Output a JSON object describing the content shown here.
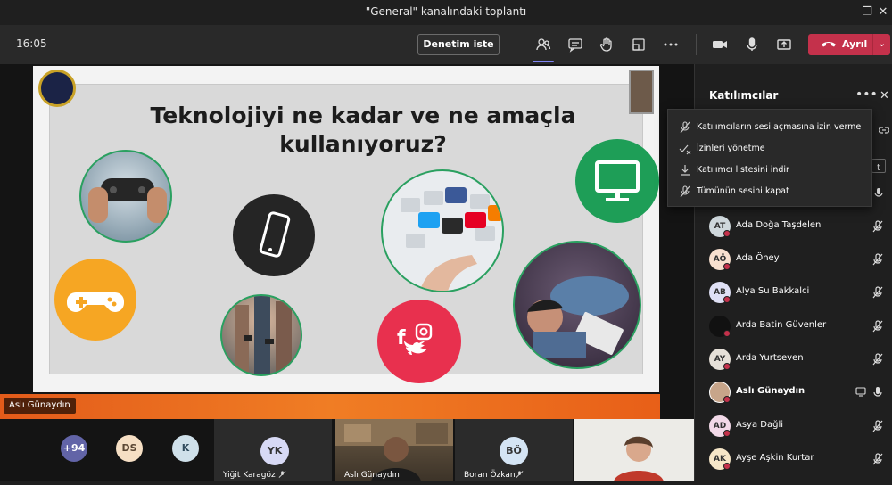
{
  "window": {
    "title": "\"General\" kanalındaki toplantı"
  },
  "toolbar": {
    "clock": "16:05",
    "request_control_label": "Denetim iste",
    "leave_label": "Ayrıl",
    "icons": [
      "people-icon",
      "chat-icon",
      "raise-hand-icon",
      "rooms-icon",
      "more-icon",
      "camera-icon",
      "microphone-icon",
      "share-icon"
    ]
  },
  "stage": {
    "presenter_name": "Aslı Günaydın",
    "slide": {
      "title_line1": "Teknolojiyi ne kadar ve ne amaçla",
      "title_line2": "kullanıyoruz?"
    }
  },
  "gallery": {
    "overflow_count": "+94",
    "avatars": [
      {
        "initials": "DS",
        "color": "#f6dfc4"
      },
      {
        "initials": "K",
        "color": "#cfe0ea"
      }
    ],
    "tiles": [
      {
        "initials": "YK",
        "name": "Yiğit Karagöz",
        "color": "#d7d9f5"
      },
      {
        "name": "Aslı Günaydın"
      },
      {
        "initials": "BÖ",
        "name": "Boran Özkan",
        "color": "#d4e4f4"
      }
    ]
  },
  "panel": {
    "title": "Katılımcılar",
    "peek_text": "t",
    "menu": [
      {
        "icon": "mic-off-icon",
        "label": "Katılımcıların sesi açmasına izin verme"
      },
      {
        "icon": "permissions-off-icon",
        "label": "İzinleri yönetme"
      },
      {
        "icon": "download-icon",
        "label": "Katılımcı listesini indir"
      },
      {
        "icon": "mute-all-icon",
        "label": "Tümünün sesini kapat"
      }
    ],
    "participants": [
      {
        "initials": "AT",
        "name": "Ada Doğa Taşdelen",
        "color": "#cfd8dc"
      },
      {
        "initials": "AÖ",
        "name": "Ada Öney",
        "color": "#f8e0cf"
      },
      {
        "initials": "AB",
        "name": "Alya Su Bakkalci",
        "color": "#dfe0f5"
      },
      {
        "initials": "",
        "name": "Arda Batin Güvenler",
        "color": "#111111"
      },
      {
        "initials": "AY",
        "name": "Arda Yurtseven",
        "color": "#e6e0d8"
      },
      {
        "initials": "",
        "name": "Aslı Günaydın",
        "color": "#c7a58a",
        "bold": true
      },
      {
        "initials": "AD",
        "name": "Asya Dağli",
        "color": "#f2d9e8"
      },
      {
        "initials": "AK",
        "name": "Ayşe Aşkin Kurtar",
        "color": "#f6e6c8"
      }
    ]
  }
}
